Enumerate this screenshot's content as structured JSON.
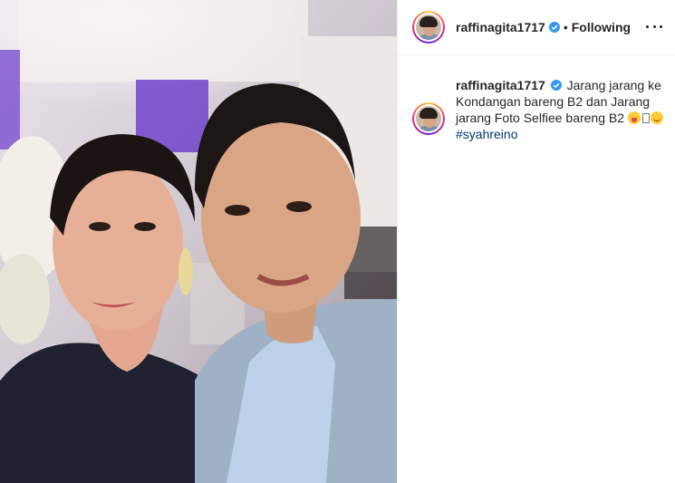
{
  "post": {
    "photo_alt": "",
    "header": {
      "username": "raffinagita1717",
      "separator": "•",
      "follow_status": "Following",
      "more_icon": "more-horizontal-icon"
    },
    "caption": {
      "username": "raffinagita1717",
      "text": "Jarang jarang ke Kondangan bareng B2 dan Jarang jarang Foto Selfiee bareng B2",
      "hashtag": "#syahreino"
    },
    "colors": {
      "verified": "#3897f0",
      "hashtag": "#00376b",
      "border": "#efefef",
      "text": "#262626"
    }
  }
}
